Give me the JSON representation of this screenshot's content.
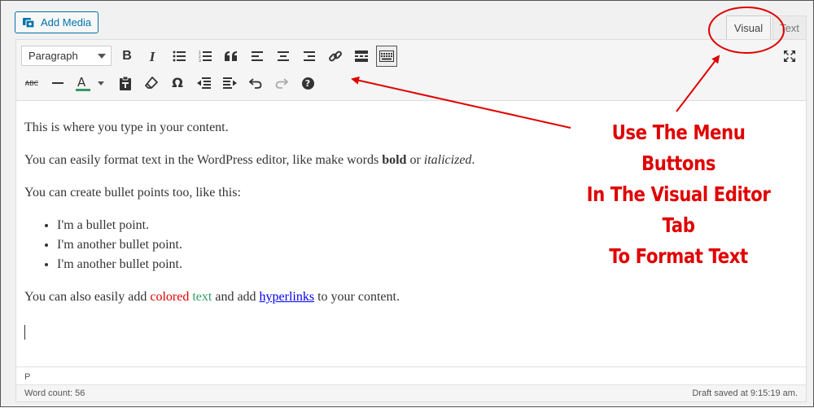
{
  "header": {
    "add_media_label": "Add Media",
    "tabs": [
      {
        "label": "Visual",
        "active": true
      },
      {
        "label": "Text",
        "active": false
      }
    ]
  },
  "toolbar": {
    "format_select_value": "Paragraph",
    "row1": [
      "bold-icon",
      "italic-icon",
      "bulleted-list-icon",
      "numbered-list-icon",
      "blockquote-icon",
      "align-left-icon",
      "align-center-icon",
      "align-right-icon",
      "link-icon",
      "read-more-icon",
      "toolbar-toggle-icon"
    ],
    "row2": [
      "strikethrough-icon",
      "horizontal-line-icon",
      "text-color-icon",
      "paste-as-text-icon",
      "clear-formatting-icon",
      "special-character-icon",
      "outdent-icon",
      "indent-icon",
      "undo-icon",
      "redo-icon",
      "help-icon"
    ],
    "bold_glyph": "B",
    "italic_glyph": "I",
    "strike_glyph": "ABC",
    "text_color_glyph": "A",
    "omega_glyph": "Ω",
    "help_glyph": "?"
  },
  "content": {
    "p1": "This is where you type in your content.",
    "p2_before": "You can easily format text in the WordPress editor, like make words ",
    "p2_bold": "bold",
    "p2_mid": " or ",
    "p2_italic": "italicized",
    "p2_end": ".",
    "p3": "You can create bullet points too, like this:",
    "bullets": [
      "I'm a bullet point.",
      "I'm another bullet point.",
      "I'm another bullet point."
    ],
    "p4_before": "You can also easily add ",
    "p4_red": "colored",
    "p4_green": "text",
    "p4_mid": " and add ",
    "p4_link": "hyperlinks",
    "p4_end": " to your content."
  },
  "path_bar": {
    "text": "P"
  },
  "status": {
    "word_count": "Word count: 56",
    "draft_saved": "Draft saved at 9:15:19 am."
  },
  "annotation": {
    "lines": [
      "Use The Menu Buttons",
      "In The Visual Editor Tab",
      "To Format Text"
    ],
    "color": "#e00000"
  },
  "colors": {
    "accent": "#0073aa",
    "text_red": "#e00000",
    "text_green": "#339966",
    "link": "#0000ee"
  }
}
